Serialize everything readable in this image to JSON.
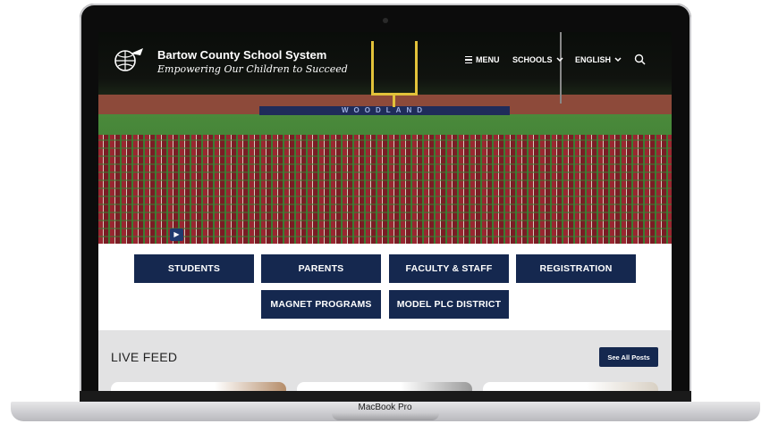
{
  "device": {
    "label": "MacBook Pro"
  },
  "site": {
    "name": "Bartow County School System",
    "tagline": "Empowering Our Children to Succeed"
  },
  "nav": {
    "menu": "MENU",
    "schools": "SCHOOLS",
    "language": "ENGLISH"
  },
  "hero": {
    "field_text": "WOODLAND"
  },
  "quick_links": [
    "STUDENTS",
    "PARENTS",
    "FACULTY & STAFF",
    "REGISTRATION",
    "MAGNET PROGRAMS",
    "MODEL PLC DISTRICT"
  ],
  "live_feed": {
    "title": "LIVE FEED",
    "see_all": "See All Posts"
  },
  "colors": {
    "navy": "#15284f",
    "feed_bg": "#e2e2e3"
  },
  "icons": {
    "search": "search-icon",
    "menu": "hamburger-icon",
    "chevron": "chevron-down-icon",
    "play": "play-icon"
  }
}
